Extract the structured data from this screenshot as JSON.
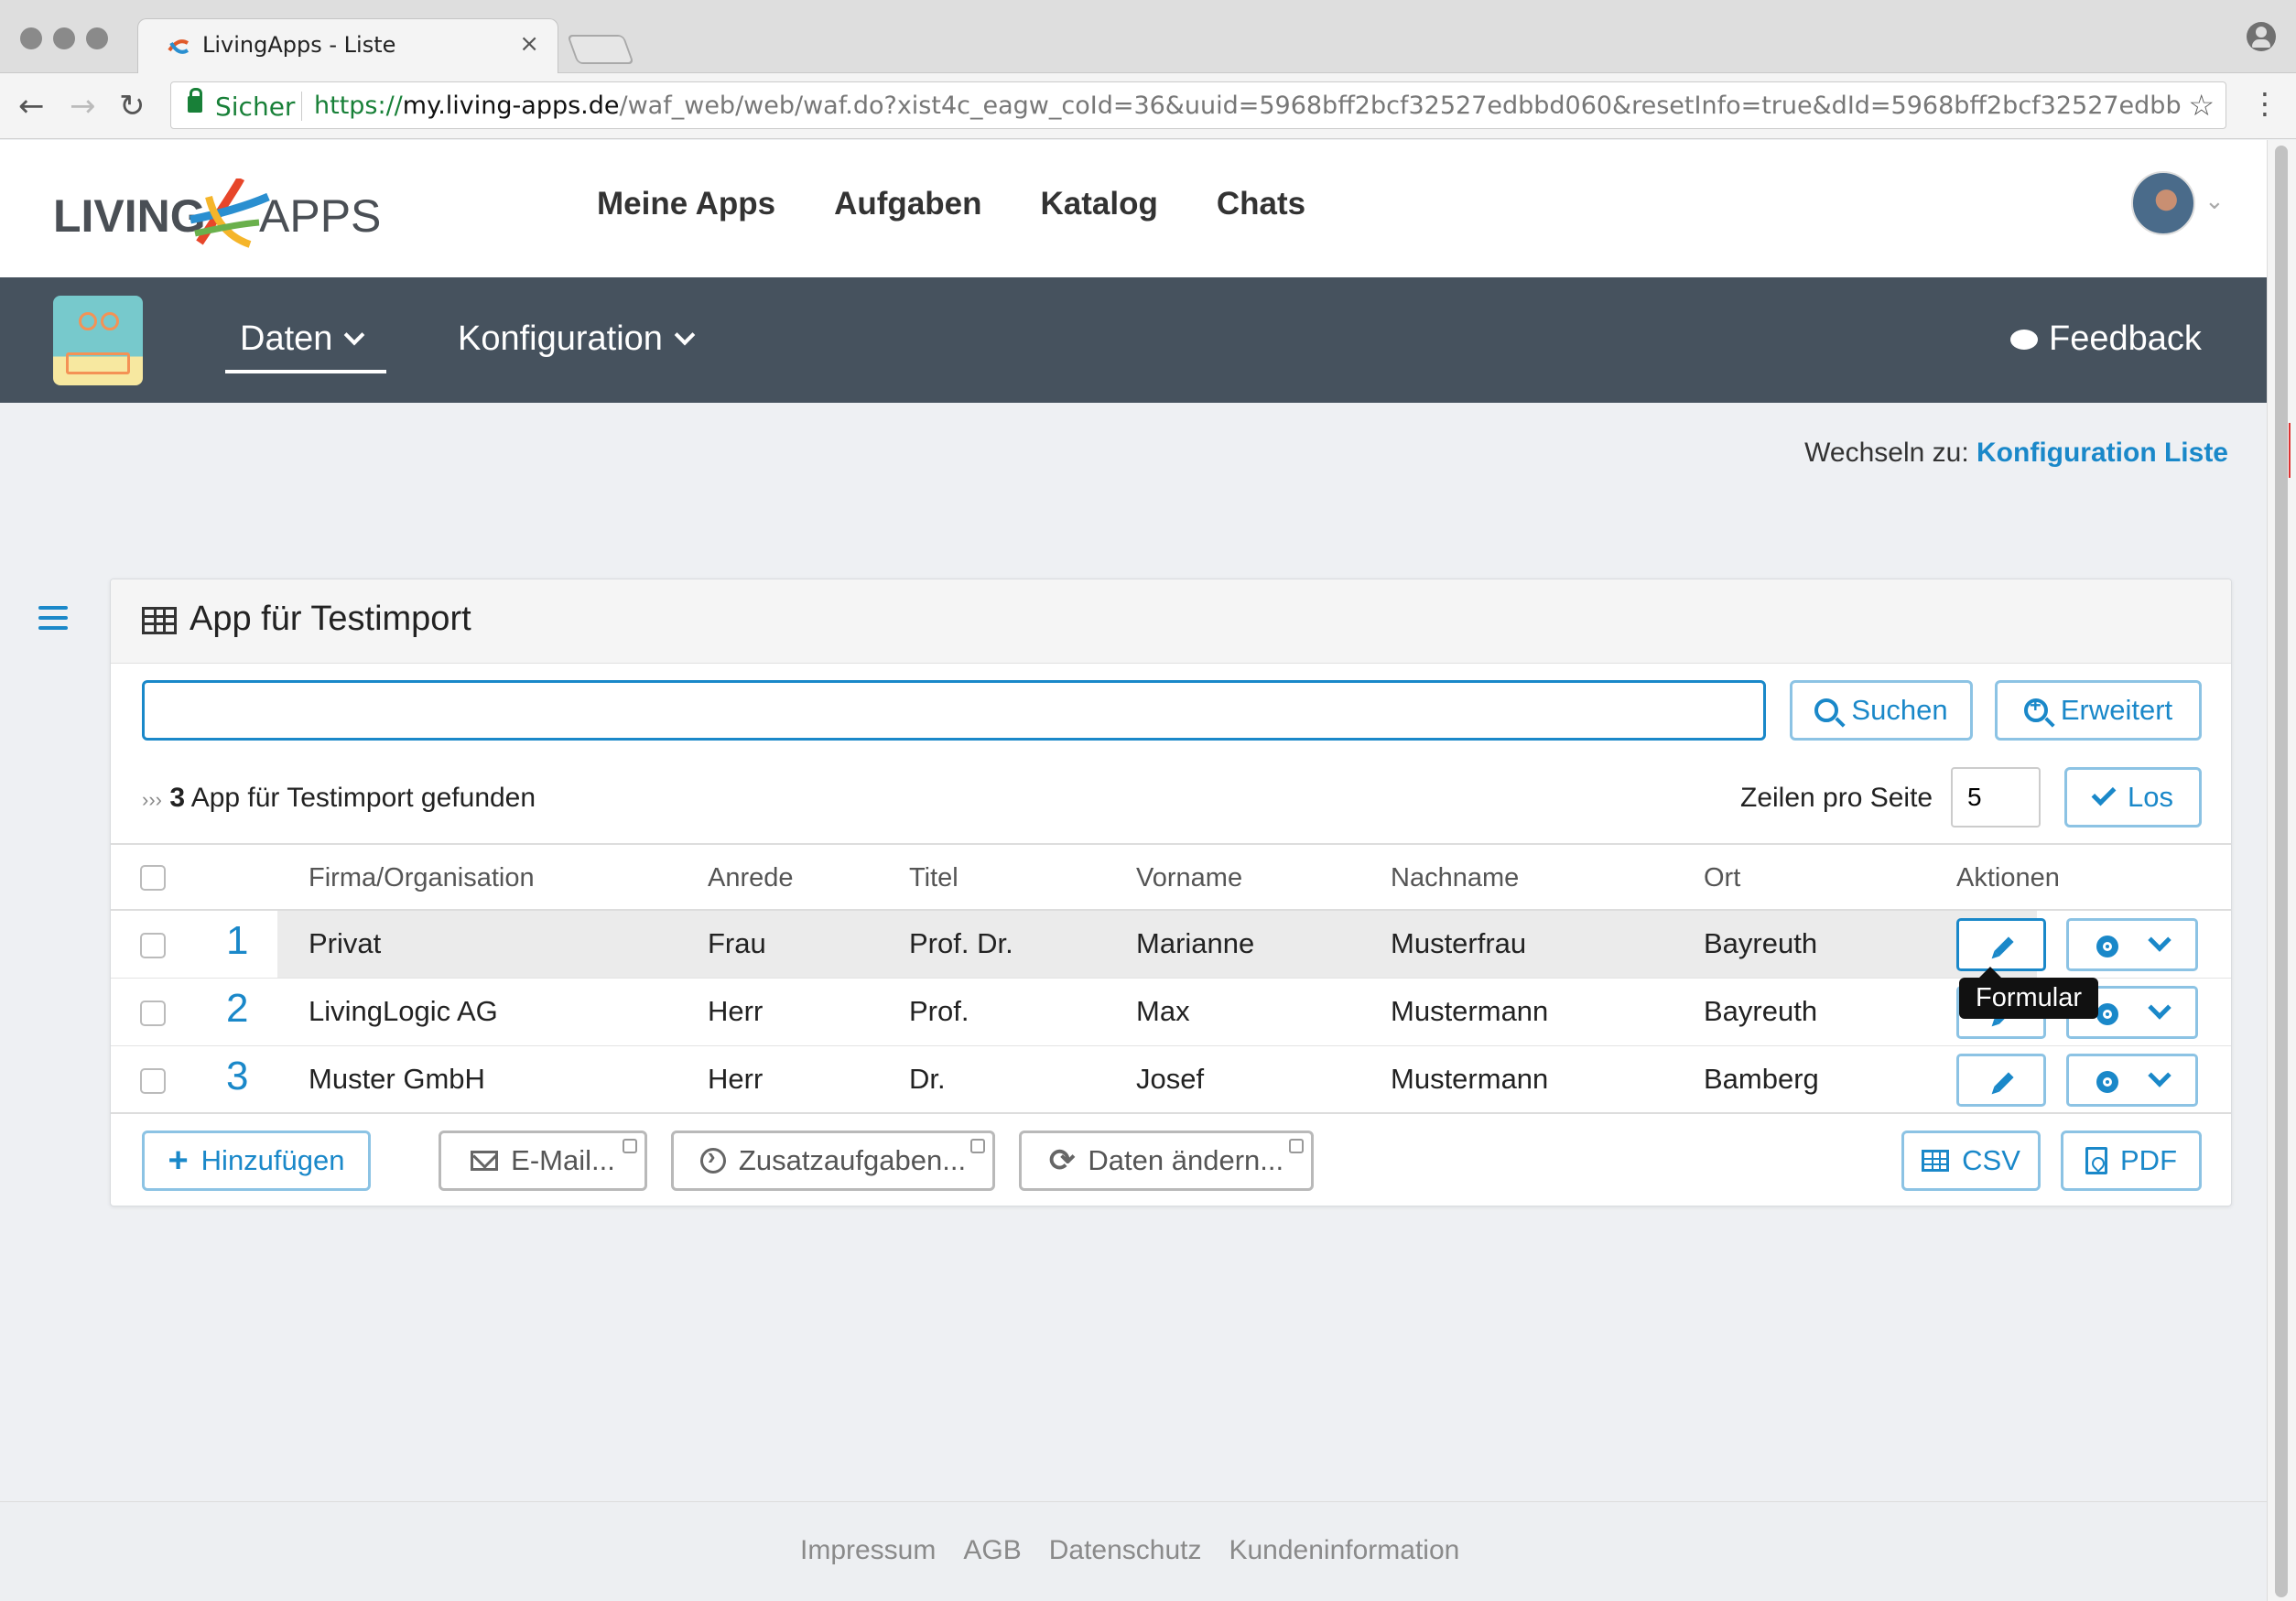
{
  "browser": {
    "tab_title": "LivingApps - Liste",
    "tab_close": "×",
    "secure_label": "Sicher",
    "url_scheme": "https://",
    "url_host": "my.living-apps.de",
    "url_path": "/waf_web/web/waf.do?xist4c_eagw_coId=36&uuid=5968bff2bcf32527edbbd060&resetInfo=true&dId=5968bff2bcf32527edbbd..."
  },
  "header": {
    "logo_left": "LIVING",
    "logo_right": "APPS",
    "nav": [
      "Meine Apps",
      "Aufgaben",
      "Katalog",
      "Chats"
    ]
  },
  "subnav": {
    "data_label": "Daten",
    "config_label": "Konfiguration",
    "feedback_label": "Feedback"
  },
  "switch": {
    "prefix": "Wechseln zu:",
    "link": "Konfiguration Liste"
  },
  "panel": {
    "title": "App für Testimport",
    "search_value": "",
    "search_button": "Suchen",
    "advanced_button": "Erweitert",
    "found_count": "3",
    "found_text": "App für Testimport gefunden",
    "rows_per_page_label": "Zeilen pro Seite",
    "rows_per_page_value": "5",
    "go_button": "Los"
  },
  "table": {
    "headers": [
      "Firma/Organisation",
      "Anrede",
      "Titel",
      "Vorname",
      "Nachname",
      "Ort",
      "Aktionen"
    ],
    "rows": [
      {
        "num": "1",
        "firma": "Privat",
        "anrede": "Frau",
        "titel": "Prof. Dr.",
        "vorname": "Marianne",
        "nachname": "Musterfrau",
        "ort": "Bayreuth"
      },
      {
        "num": "2",
        "firma": "LivingLogic AG",
        "anrede": "Herr",
        "titel": "Prof.",
        "vorname": "Max",
        "nachname": "Mustermann",
        "ort": "Bayreuth"
      },
      {
        "num": "3",
        "firma": "Muster GmbH",
        "anrede": "Herr",
        "titel": "Dr.",
        "vorname": "Josef",
        "nachname": "Mustermann",
        "ort": "Bamberg"
      }
    ],
    "tooltip": "Formular"
  },
  "footer_actions": {
    "add": "Hinzufügen",
    "email": "E-Mail...",
    "extra_tasks": "Zusatzaufgaben...",
    "change_data": "Daten ändern...",
    "csv": "CSV",
    "pdf": "PDF"
  },
  "footer": {
    "links": [
      "Impressum",
      "AGB",
      "Datenschutz",
      "Kundeninformation"
    ]
  },
  "colors": {
    "accent": "#1a88c9",
    "subnav_bg": "#46525e",
    "page_bg": "#eef0f3",
    "secure_green": "#188038"
  }
}
